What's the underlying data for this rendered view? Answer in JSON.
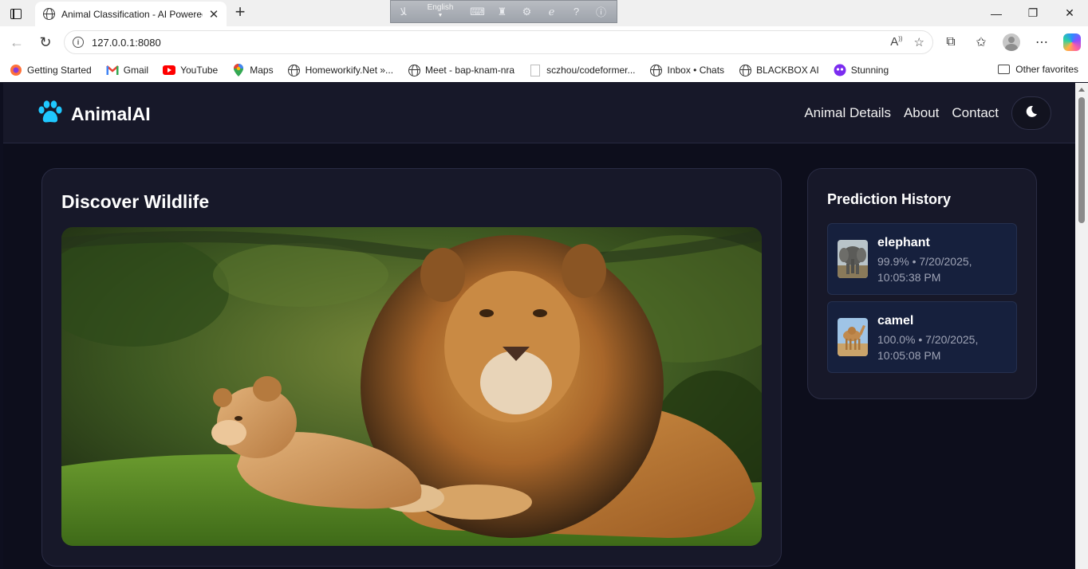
{
  "browser": {
    "tab_title": "Animal Classification - AI Powered",
    "url": "127.0.0.1:8080",
    "ime_language": "English",
    "bookmarks": [
      {
        "label": "Getting Started",
        "icon": "firefox-icon"
      },
      {
        "label": "Gmail",
        "icon": "gmail-icon"
      },
      {
        "label": "YouTube",
        "icon": "youtube-icon"
      },
      {
        "label": "Maps",
        "icon": "maps-icon"
      },
      {
        "label": "Homeworkify.Net »...",
        "icon": "globe-icon"
      },
      {
        "label": "Meet - bap-knam-nra",
        "icon": "globe-icon"
      },
      {
        "label": "sczhou/codeformer...",
        "icon": "page-icon"
      },
      {
        "label": "Inbox • Chats",
        "icon": "globe-icon"
      },
      {
        "label": "BLACKBOX AI",
        "icon": "globe-icon"
      },
      {
        "label": "Stunning",
        "icon": "stunning-icon"
      }
    ],
    "other_favorites": "Other favorites"
  },
  "site": {
    "logo": "AnimalAI",
    "nav": [
      "Animal Details",
      "About",
      "Contact"
    ],
    "accent": "#1fc8ff",
    "theme_icon": "moon-icon"
  },
  "main": {
    "title": "Discover Wildlife",
    "hero_image": "lion-and-cub-photo"
  },
  "history": {
    "title": "Prediction History",
    "items": [
      {
        "animal": "elephant",
        "meta": "99.9% • 7/20/2025, 10:05:38 PM",
        "thumb": "elephant-thumbnail"
      },
      {
        "animal": "camel",
        "meta": "100.0% • 7/20/2025, 10:05:08 PM",
        "thumb": "camel-thumbnail"
      }
    ]
  }
}
